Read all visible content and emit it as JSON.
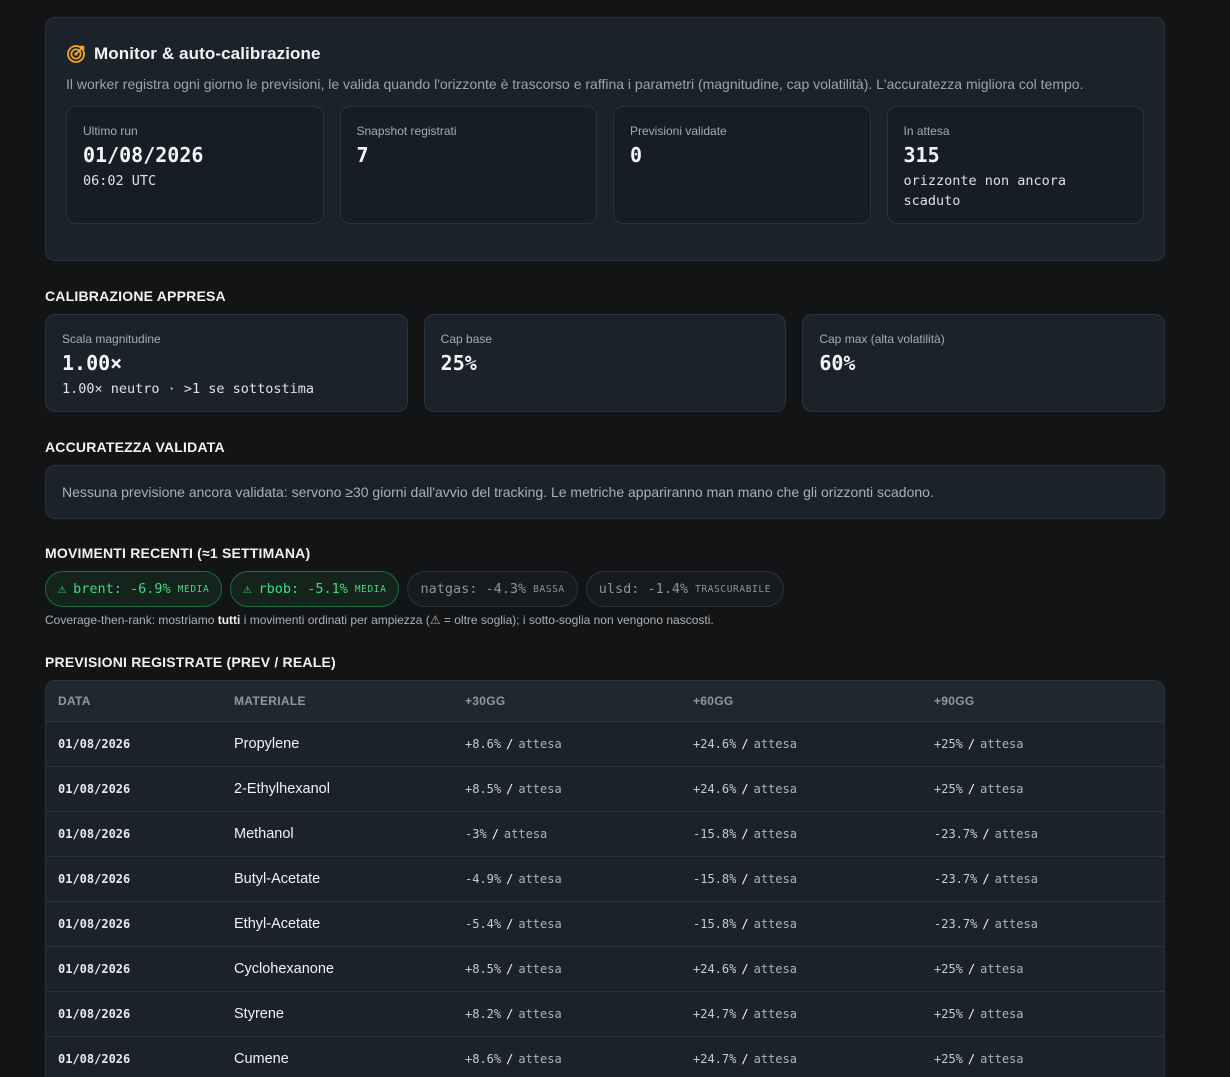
{
  "monitor": {
    "title": "Monitor & auto-calibrazione",
    "description": "Il worker registra ogni giorno le previsioni, le valida quando l'orizzonte è trascorso e raffina i parametri (magnitudine, cap volatilità). L'accuratezza migliora col tempo.",
    "stats": [
      {
        "label": "Ultimo run",
        "value": "01/08/2026",
        "sub": "06:02 UTC"
      },
      {
        "label": "Snapshot registrati",
        "value": "7",
        "sub": ""
      },
      {
        "label": "Previsioni validate",
        "value": "0",
        "sub": ""
      },
      {
        "label": "In attesa",
        "value": "315",
        "sub": "orizzonte non ancora scaduto"
      }
    ]
  },
  "calibration": {
    "heading": "Calibrazione appresa",
    "cards": [
      {
        "label": "Scala magnitudine",
        "value": "1.00×",
        "sub": "1.00× neutro · >1 se sottostima"
      },
      {
        "label": "Cap base",
        "value": "25%",
        "sub": ""
      },
      {
        "label": "Cap max (alta volatilità)",
        "value": "60%",
        "sub": ""
      }
    ]
  },
  "accuracy": {
    "heading": "Accuratezza validata",
    "notice": "Nessuna previsione ancora validata: servono ≥30 giorni dall'avvio del tracking. Le metriche appariranno man mano che gli orizzonti scadono."
  },
  "movements": {
    "heading": "Movimenti recenti (≈1 settimana)",
    "pills": [
      {
        "icon": "⚠",
        "text": "brent: -6.9%",
        "level": "media",
        "warn": true
      },
      {
        "icon": "⚠",
        "text": "rbob: -5.1%",
        "level": "media",
        "warn": true
      },
      {
        "icon": "",
        "text": "natgas: -4.3%",
        "level": "bassa",
        "warn": false
      },
      {
        "icon": "",
        "text": "ulsd: -1.4%",
        "level": "trascurabile",
        "warn": false
      }
    ],
    "note_prefix": "Coverage-then-rank: mostriamo ",
    "note_bold": "tutti",
    "note_suffix": " i movimenti ordinati per ampiezza (⚠ = oltre soglia); i sotto-soglia non vengono nascosti."
  },
  "forecasts": {
    "heading": "Previsioni registrate (prev / reale)",
    "columns": [
      "Data",
      "Materiale",
      "+30gg",
      "+60gg",
      "+90gg"
    ],
    "separator": "/",
    "rows": [
      {
        "date": "01/08/2026",
        "material": "Propylene",
        "d30": "+8.6%",
        "r30": "attesa",
        "d60": "+24.6%",
        "r60": "attesa",
        "d90": "+25%",
        "r90": "attesa"
      },
      {
        "date": "01/08/2026",
        "material": "2-Ethylhexanol",
        "d30": "+8.5%",
        "r30": "attesa",
        "d60": "+24.6%",
        "r60": "attesa",
        "d90": "+25%",
        "r90": "attesa"
      },
      {
        "date": "01/08/2026",
        "material": "Methanol",
        "d30": "-3%",
        "r30": "attesa",
        "d60": "-15.8%",
        "r60": "attesa",
        "d90": "-23.7%",
        "r90": "attesa"
      },
      {
        "date": "01/08/2026",
        "material": "Butyl-Acetate",
        "d30": "-4.9%",
        "r30": "attesa",
        "d60": "-15.8%",
        "r60": "attesa",
        "d90": "-23.7%",
        "r90": "attesa"
      },
      {
        "date": "01/08/2026",
        "material": "Ethyl-Acetate",
        "d30": "-5.4%",
        "r30": "attesa",
        "d60": "-15.8%",
        "r60": "attesa",
        "d90": "-23.7%",
        "r90": "attesa"
      },
      {
        "date": "01/08/2026",
        "material": "Cyclohexanone",
        "d30": "+8.5%",
        "r30": "attesa",
        "d60": "+24.6%",
        "r60": "attesa",
        "d90": "+25%",
        "r90": "attesa"
      },
      {
        "date": "01/08/2026",
        "material": "Styrene",
        "d30": "+8.2%",
        "r30": "attesa",
        "d60": "+24.7%",
        "r60": "attesa",
        "d90": "+25%",
        "r90": "attesa"
      },
      {
        "date": "01/08/2026",
        "material": "Cumene",
        "d30": "+8.6%",
        "r30": "attesa",
        "d60": "+24.7%",
        "r60": "attesa",
        "d90": "+25%",
        "r90": "attesa"
      }
    ]
  },
  "colors": {
    "accent_icon": "#f5a524",
    "warn_green": "#3ddc84",
    "panel": "#1b222a",
    "background": "#131415"
  },
  "icons": {
    "monitor": "target-icon",
    "warn": "warning-icon"
  }
}
